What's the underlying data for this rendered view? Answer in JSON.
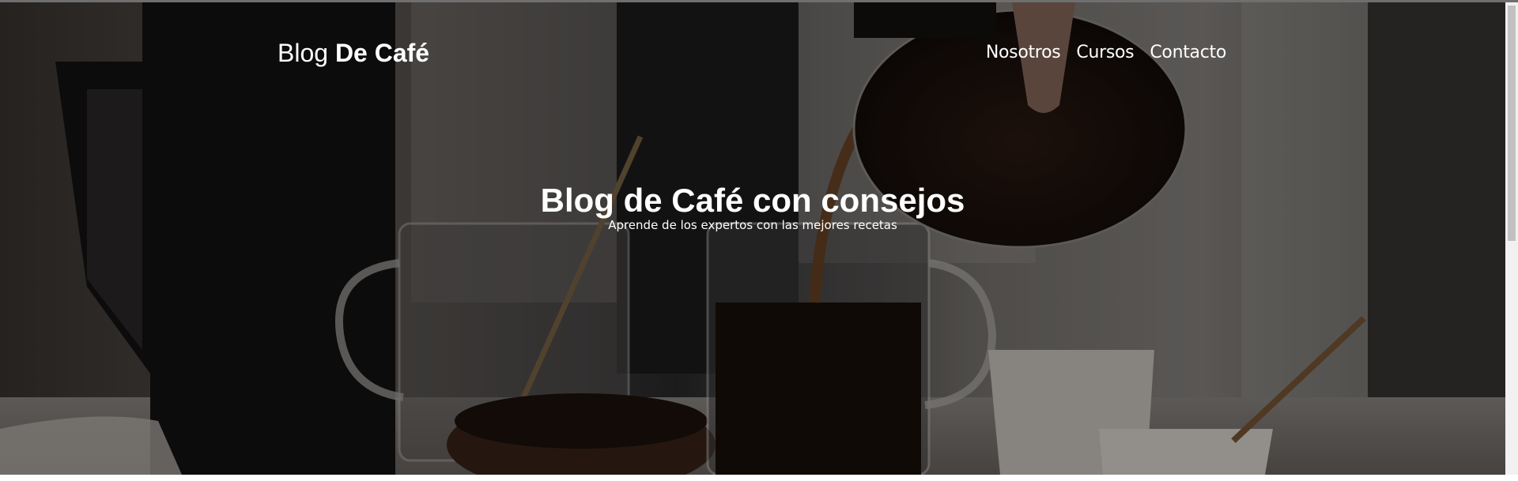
{
  "header": {
    "logo_regular": "Blog ",
    "logo_bold": "De Café",
    "nav": [
      {
        "label": "Nosotros"
      },
      {
        "label": "Cursos"
      },
      {
        "label": "Contacto"
      }
    ]
  },
  "hero": {
    "title": "Blog de Café con consejos",
    "subtitle": "Aprende de los expertos con las mejores recetas"
  },
  "colors": {
    "text": "#ffffff",
    "overlay": "rgba(0,0,0,0.35)"
  }
}
